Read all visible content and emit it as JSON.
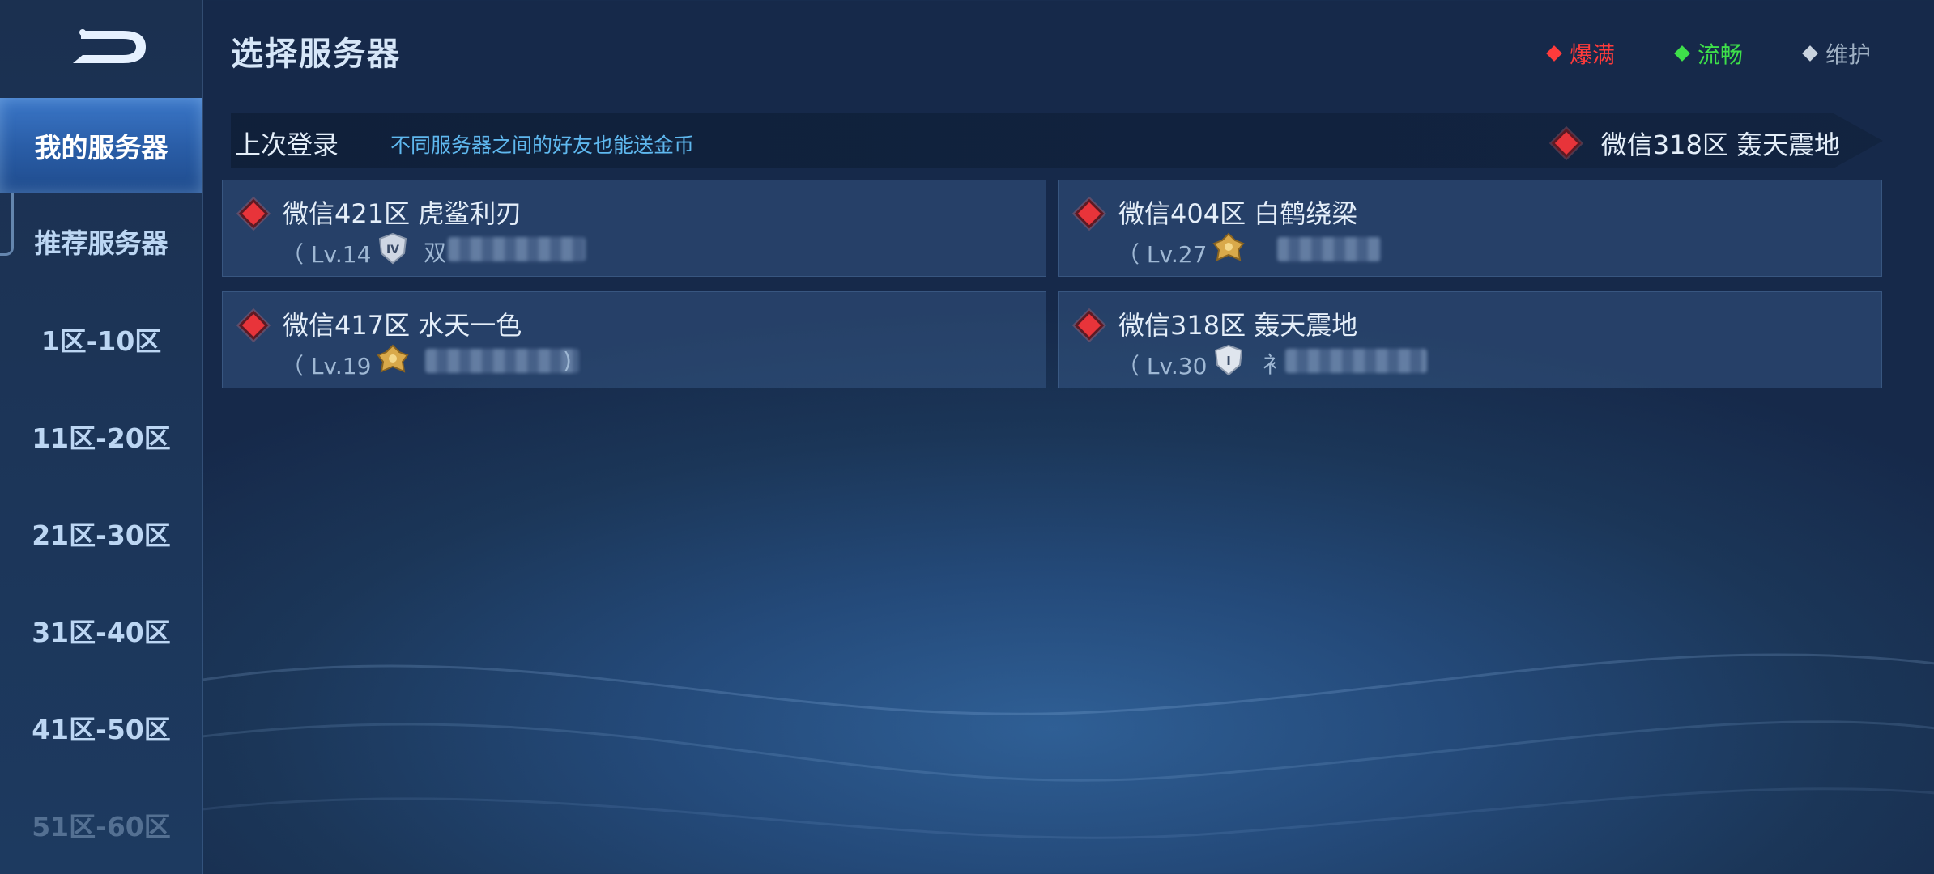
{
  "header": {
    "title": "选择服务器",
    "legend": [
      {
        "label": "爆满",
        "color": "#ff3b3b"
      },
      {
        "label": "流畅",
        "color": "#3ee04a"
      },
      {
        "label": "维护",
        "color": "#c9d3df"
      }
    ]
  },
  "sidebar": {
    "items": [
      {
        "label": "我的服务器",
        "active": true
      },
      {
        "label": "推荐服务器"
      },
      {
        "label": "1区-10区"
      },
      {
        "label": "11区-20区"
      },
      {
        "label": "21区-30区"
      },
      {
        "label": "31区-40区"
      },
      {
        "label": "41区-50区"
      },
      {
        "label": "51区-60区"
      }
    ]
  },
  "last_login": {
    "label": "上次登录",
    "tip": "不同服务器之间的好友也能送金币",
    "server": "微信318区 轰天震地",
    "status_color": "#e8343a"
  },
  "servers": [
    {
      "name": "微信421区 虎鲨利刃",
      "level": "Lv.14",
      "rank_icon": "rank-iv-silver-icon",
      "nick_prefix": "双",
      "close_paren": ""
    },
    {
      "name": "微信404区 白鹤绕梁",
      "level": "Lv.27",
      "rank_icon": "rank-gold-icon",
      "nick_prefix": "",
      "close_paren": ""
    },
    {
      "name": "微信417区 水天一色",
      "level": "Lv.19",
      "rank_icon": "rank-gold-icon",
      "nick_prefix": "",
      "close_paren": ")"
    },
    {
      "name": "微信318区 轰天震地",
      "level": "Lv.30",
      "rank_icon": "rank-i-silver-icon",
      "nick_prefix": "衤",
      "close_paren": ""
    }
  ]
}
